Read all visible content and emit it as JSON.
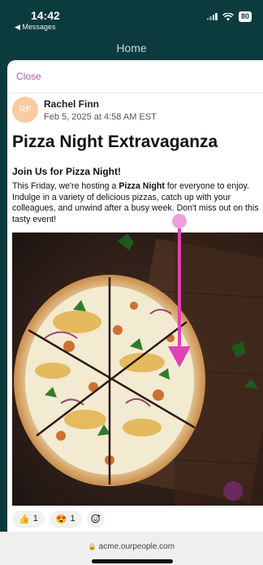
{
  "status": {
    "time": "14:42",
    "back_app": "◀ Messages",
    "battery": "80"
  },
  "nav": {
    "title": "Home"
  },
  "sheet": {
    "close_label": "Close"
  },
  "post": {
    "avatar_initials": "RF",
    "author": "Rachel Finn",
    "timestamp": "Feb 5, 2025 at 4:58 AM EST",
    "title": "Pizza Night Extravaganza",
    "subheading": "Join Us for Pizza Night!",
    "body_pre": "This Friday, we're hosting a ",
    "body_bold": "Pizza Night",
    "body_post": " for everyone to enjoy. Indulge in a variety of delicious pizzas, catch up with your colleagues, and unwind after a busy week. Don't miss out on this tasty event!"
  },
  "reactions": [
    {
      "icon": "thumbs-up-emoji",
      "glyph": "👍",
      "count": "1"
    },
    {
      "icon": "heart-eyes-emoji",
      "glyph": "😍",
      "count": "1"
    }
  ],
  "browser": {
    "url": "acme.ourpeople.com"
  },
  "colors": {
    "brand": "#0c3b3d",
    "accent": "#b55aa5",
    "gesture": "#e040b8"
  }
}
